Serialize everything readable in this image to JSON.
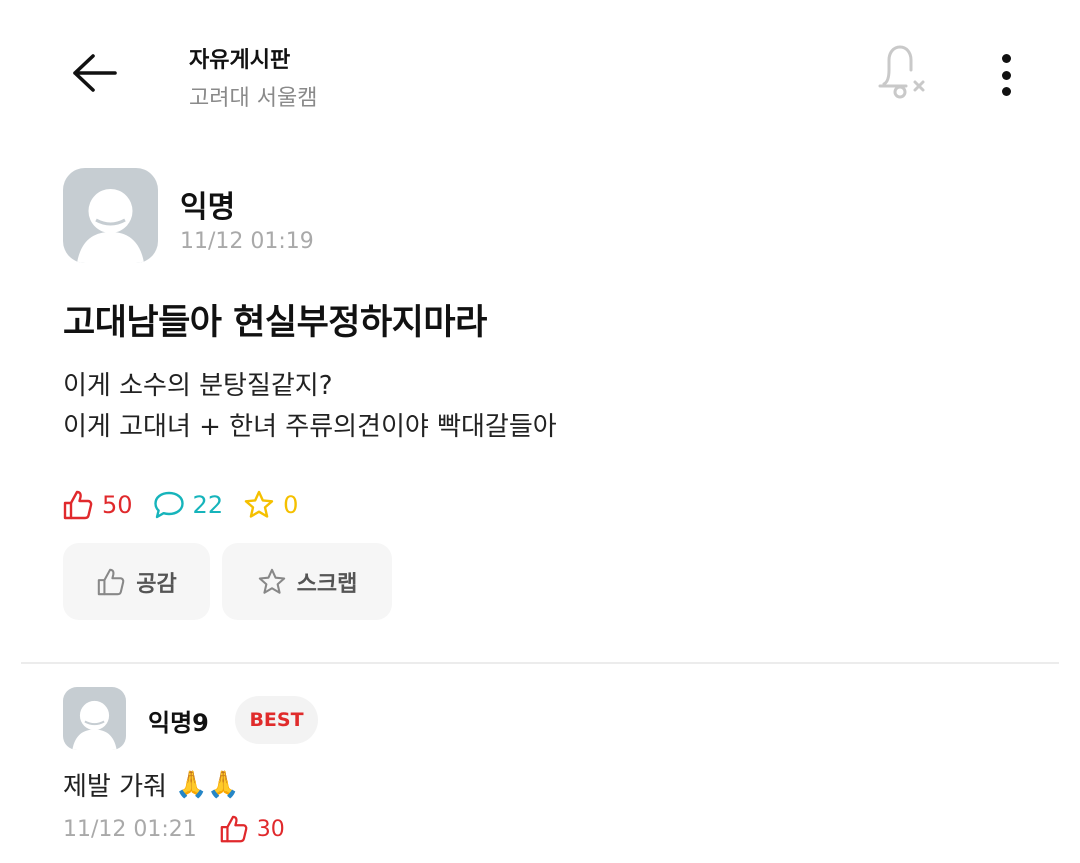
{
  "header": {
    "board_title": "자유게시판",
    "board_subtitle": "고려대 서울캠",
    "back_icon": "arrow-left-icon",
    "bell_icon": "bell-off-icon",
    "more_icon": "more-vertical-icon"
  },
  "post": {
    "author": "익명",
    "time": "11/12 01:19",
    "title": "고대남들아 현실부정하지마라",
    "body_lines": [
      "이게 소수의 분탕질같지?",
      "이게 고대녀 + 한녀 주류의견이야 빡대갈들아"
    ],
    "stats": {
      "likes": "50",
      "comments": "22",
      "scraps": "0"
    },
    "actions": {
      "like_label": "공감",
      "scrap_label": "스크랩"
    }
  },
  "comment": {
    "author": "익명9",
    "badge": "BEST",
    "body": "제발 가줘",
    "emoji": "🙏🙏",
    "time": "11/12 01:21",
    "likes": "30"
  },
  "colors": {
    "like": "#e0292c",
    "comment": "#16b4bb",
    "scrap": "#f5c000",
    "muted": "#a9a9a9",
    "avatar_bg": "#c6cdd2"
  }
}
